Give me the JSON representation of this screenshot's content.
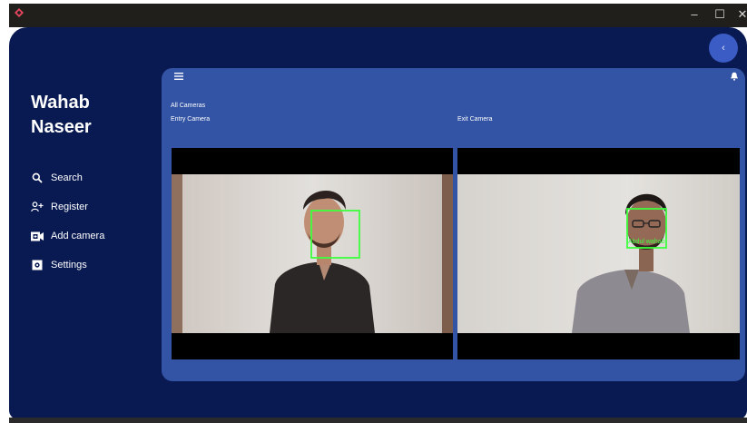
{
  "window": {
    "controls": {
      "minimize": "–",
      "maximize": "☐",
      "close": "✕"
    },
    "back_button": "‹"
  },
  "sidebar": {
    "user_name_line1": "Wahab",
    "user_name_line2": "Naseer",
    "items": [
      {
        "label": "Search",
        "icon": "search-icon"
      },
      {
        "label": "Register",
        "icon": "add-person-icon"
      },
      {
        "label": "Add camera",
        "icon": "camera-icon"
      },
      {
        "label": "Settings",
        "icon": "settings-icon"
      }
    ]
  },
  "main": {
    "heading": "All Cameras",
    "cameras": [
      {
        "label": "Entry Camera",
        "detection_label": ""
      },
      {
        "label": "Exit Camera",
        "detection_label": "Abdul wahab"
      }
    ]
  },
  "colors": {
    "window_bg": "#091a52",
    "panel_bg": "#3353a4",
    "fab_bg": "#3a5cc4",
    "detection_box": "#3cff3c",
    "app_logo": "#e8475f"
  }
}
